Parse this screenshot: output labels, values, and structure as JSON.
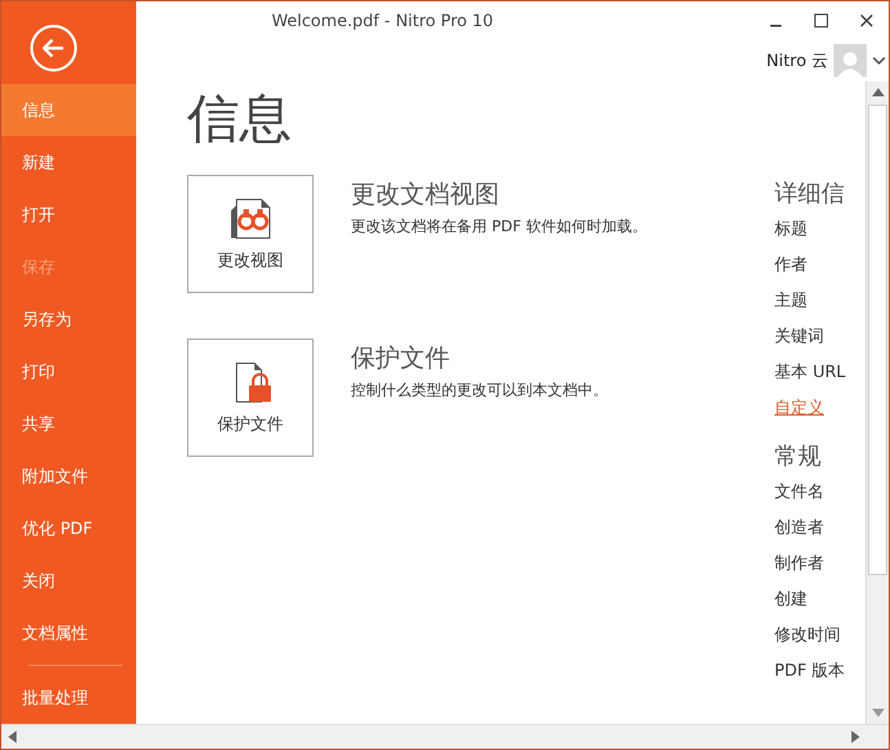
{
  "window": {
    "title": "Welcome.pdf - Nitro Pro 10"
  },
  "account": {
    "label": "Nitro 云"
  },
  "sidebar": {
    "items": [
      {
        "label": "信息",
        "selected": true,
        "disabled": false
      },
      {
        "label": "新建",
        "selected": false,
        "disabled": false
      },
      {
        "label": "打开",
        "selected": false,
        "disabled": false
      },
      {
        "label": "保存",
        "selected": false,
        "disabled": true
      },
      {
        "label": "另存为",
        "selected": false,
        "disabled": false
      },
      {
        "label": "打印",
        "selected": false,
        "disabled": false
      },
      {
        "label": "共享",
        "selected": false,
        "disabled": false
      },
      {
        "label": "附加文件",
        "selected": false,
        "disabled": false
      },
      {
        "label": "优化 PDF",
        "selected": false,
        "disabled": false
      },
      {
        "label": "关闭",
        "selected": false,
        "disabled": false
      },
      {
        "label": "文档属性",
        "selected": false,
        "disabled": false
      }
    ],
    "footer_items": [
      {
        "label": "批量处理",
        "selected": false,
        "disabled": false
      }
    ]
  },
  "page_title": "信息",
  "actions": [
    {
      "kind": "view",
      "button_label": "更改视图",
      "heading": "更改文档视图",
      "description": "更改该文档将在备用 PDF 软件如何时加载。"
    },
    {
      "kind": "protect",
      "button_label": "保护文件",
      "heading": "保护文件",
      "description": "控制什么类型的更改可以到本文档中。"
    }
  ],
  "details": {
    "heading": "详细信",
    "fields": [
      "标题",
      "作者",
      "主题",
      "关键词",
      "基本 URL"
    ],
    "link": "自定义"
  },
  "general": {
    "heading": "常规",
    "fields": [
      "文件名",
      "创造者",
      "制作者",
      "创建",
      "修改时间",
      "PDF 版本"
    ]
  }
}
